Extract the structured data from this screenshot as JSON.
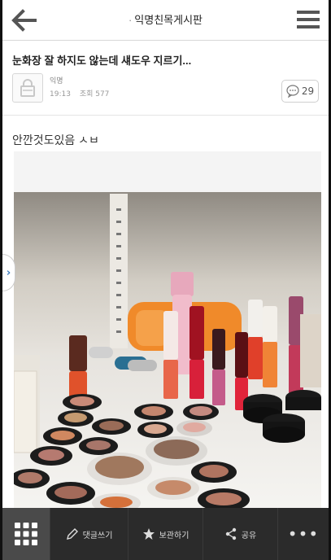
{
  "header": {
    "title": "익명친목게시판",
    "title_prefix": "·"
  },
  "post": {
    "title": "눈화장 잘 하지도 않는데 섀도우 지르기...",
    "author": "익명",
    "date_label": "19:13",
    "views_label": "조회 577",
    "comment_count": "29",
    "body": "안깐것도있음 ㅅㅂ"
  },
  "bottom_bar": {
    "write_label": "댓글쓰기",
    "save_label": "보관하기",
    "share_label": "공유",
    "more_label": "•••"
  },
  "colors": {
    "bottom_bar": "#2b2b2b",
    "side_tab_arrow": "#3a7bbf"
  }
}
